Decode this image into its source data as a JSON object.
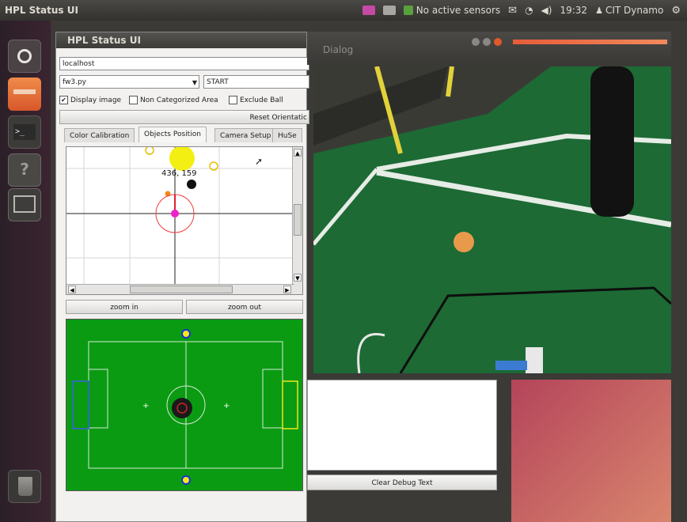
{
  "top_panel": {
    "title": "HPL Status UI",
    "sensor_status": "No active sensors",
    "clock": "19:32",
    "user": "CIT Dynamo"
  },
  "window": {
    "title": "HPL Status UI",
    "host_value": "localhost",
    "script_value": "fw3.py",
    "start_value": "START",
    "checkboxes": [
      {
        "label": "Display image",
        "checked": true
      },
      {
        "label": "Non Categorized Area",
        "checked": false
      },
      {
        "label": "Exclude Ball",
        "checked": false
      }
    ],
    "reset_label": "Reset Orientatic",
    "tabs": [
      {
        "label": "Color Calibration"
      },
      {
        "label": "Objects Position"
      },
      {
        "label": "Camera Setup"
      },
      {
        "label": "HuSe"
      }
    ],
    "coord_readout": "436,  159",
    "zoom_in_label": "zoom in",
    "zoom_out_label": "zoom out"
  },
  "dialog": {
    "title": "Dialog",
    "clear_label": "Clear Debug Text"
  }
}
